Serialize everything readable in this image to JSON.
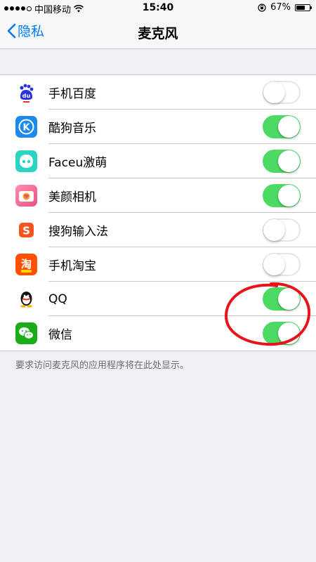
{
  "status_bar": {
    "carrier": "中国移动",
    "time": "15:40",
    "battery_percent": "67%",
    "battery_level": 0.67
  },
  "nav": {
    "back_label": "隐私",
    "title": "麦克风"
  },
  "apps": [
    {
      "name": "手机百度",
      "icon": "baidu-icon",
      "icon_color": "#FFFFFF",
      "icon_text": "du",
      "enabled": false
    },
    {
      "name": "酷狗音乐",
      "icon": "kugou-icon",
      "icon_color": "#1A8BEA",
      "icon_text": "K",
      "enabled": true
    },
    {
      "name": "Faceu激萌",
      "icon": "faceu-icon",
      "icon_color": "#2CD4C4",
      "icon_text": "",
      "enabled": true
    },
    {
      "name": "美颜相机",
      "icon": "meiyan-camera-icon",
      "icon_color": "#F06292",
      "icon_text": "",
      "enabled": true
    },
    {
      "name": "搜狗输入法",
      "icon": "sogou-icon",
      "icon_color": "#FFFFFF",
      "icon_text": "S",
      "enabled": false
    },
    {
      "name": "手机淘宝",
      "icon": "taobao-icon",
      "icon_color": "#FF5000",
      "icon_text": "淘",
      "enabled": false
    },
    {
      "name": "QQ",
      "icon": "qq-icon",
      "icon_color": "#FFFFFF",
      "icon_text": "",
      "enabled": true
    },
    {
      "name": "微信",
      "icon": "wechat-icon",
      "icon_color": "#1AAD19",
      "icon_text": "",
      "enabled": true
    }
  ],
  "footer_note": "要求访问麦克风的应用程序将在此处显示。",
  "colors": {
    "accent": "#007AFF",
    "toggle_on": "#4CD964",
    "annotation": "#E8141C"
  }
}
